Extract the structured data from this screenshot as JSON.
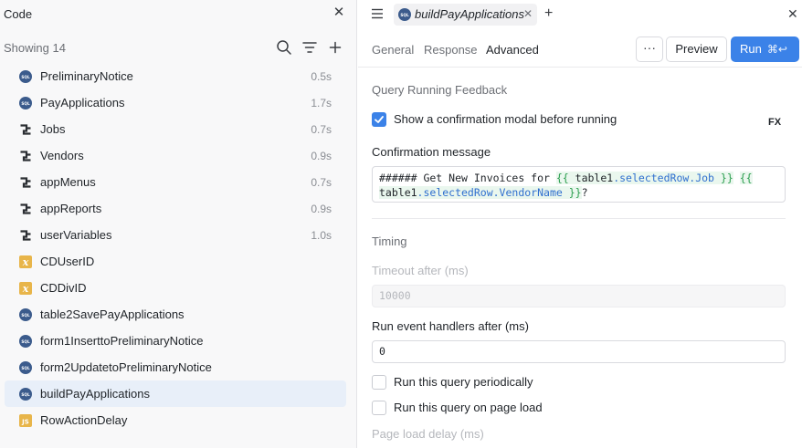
{
  "left_panel": {
    "title": "Code",
    "showing": "Showing 14",
    "items": [
      {
        "name": "PreliminaryNotice",
        "type": "sql",
        "time": "0.5s"
      },
      {
        "name": "PayApplications",
        "type": "sql",
        "time": "1.7s"
      },
      {
        "name": "Jobs",
        "type": "workflow",
        "time": "0.7s"
      },
      {
        "name": "Vendors",
        "type": "workflow",
        "time": "0.9s"
      },
      {
        "name": "appMenus",
        "type": "workflow",
        "time": "0.7s"
      },
      {
        "name": "appReports",
        "type": "workflow",
        "time": "0.9s"
      },
      {
        "name": "userVariables",
        "type": "workflow",
        "time": "1.0s"
      },
      {
        "name": "CDUserID",
        "type": "variable",
        "time": ""
      },
      {
        "name": "CDDivID",
        "type": "variable",
        "time": ""
      },
      {
        "name": "table2SavePayApplications",
        "type": "sql",
        "time": ""
      },
      {
        "name": "form1InserttoPreliminaryNotice",
        "type": "sql",
        "time": ""
      },
      {
        "name": "form2UpdatetoPreliminaryNotice",
        "type": "sql",
        "time": ""
      },
      {
        "name": "buildPayApplications",
        "type": "sql",
        "time": "",
        "active": true
      },
      {
        "name": "RowActionDelay",
        "type": "js",
        "time": ""
      }
    ]
  },
  "tab": {
    "label": "buildPayApplications"
  },
  "subtabs": [
    "General",
    "Response",
    "Advanced"
  ],
  "active_subtab": "Advanced",
  "toolbar": {
    "more": "···",
    "preview": "Preview",
    "run": "Run",
    "run_shortcut": "⌘↩"
  },
  "feedback": {
    "section_title": "Query Running Feedback",
    "confirm_label": "Show a confirmation modal before running",
    "confirm_checked": true,
    "fx": "FX",
    "message_label": "Confirmation message",
    "message_prefix": "###### Get New Invoices for ",
    "message_tpl1_open": "{{",
    "message_tpl1_obj": " table1",
    "message_tpl1_prop": ".selectedRow.Job",
    "message_tpl1_close": " }}",
    "message_tpl2_open": "{{",
    "message_tpl2_obj": "table1",
    "message_tpl2_prop": ".selectedRow.VendorName",
    "message_tpl2_close": " }}",
    "message_suffix": "?"
  },
  "timing": {
    "section_title": "Timing",
    "timeout_label": "Timeout after (ms)",
    "timeout_placeholder": "10000",
    "event_label": "Run event handlers after (ms)",
    "event_value": "0",
    "periodic_label": "Run this query periodically",
    "pageload_label": "Run this query on page load",
    "pageload_delay_label": "Page load delay (ms)"
  },
  "colors": {
    "accent": "#3b82e8",
    "sql_icon": "#3b5b8c",
    "variable_icon": "#e8b54a",
    "js_icon": "#e8b54a",
    "active_row": "#e8eff9"
  }
}
